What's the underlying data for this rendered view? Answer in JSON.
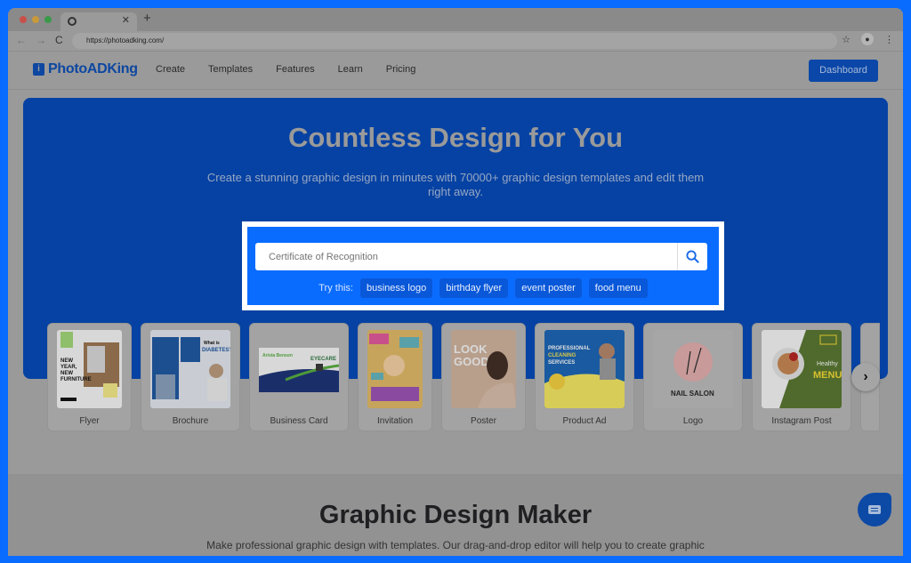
{
  "browser": {
    "tab_title": "",
    "url": "https://photoadking.com/",
    "traffic_lights": [
      "#c9504a",
      "#c99a3a",
      "#3a9a4a"
    ]
  },
  "header": {
    "logo_text": "PhotoADKing",
    "logo_mark": "i",
    "nav": [
      "Create",
      "Templates",
      "Features",
      "Learn",
      "Pricing"
    ],
    "dashboard_label": "Dashboard"
  },
  "hero": {
    "title": "Countless Design for You",
    "subtitle": "Create a stunning graphic design in minutes with 70000+ graphic design templates and edit them right away.",
    "search": {
      "placeholder": "Certificate of Recognition",
      "value": ""
    },
    "try_label": "Try this:",
    "suggestions": [
      "business logo",
      "birthday flyer",
      "event poster",
      "food menu"
    ]
  },
  "categories": [
    {
      "label": "Flyer",
      "thumb_text": "NEW YEAR, NEW FURNITURE"
    },
    {
      "label": "Brochure",
      "thumb_text": "What is DIABETES?"
    },
    {
      "label": "Business Card",
      "thumb_text": "EYECARE"
    },
    {
      "label": "Invitation",
      "thumb_text": ""
    },
    {
      "label": "Poster",
      "thumb_text": "LOOK GOOD"
    },
    {
      "label": "Product Ad",
      "thumb_text": "PROFESSIONAL CLEANING SERVICES"
    },
    {
      "label": "Logo",
      "thumb_text": "NAIL SALON"
    },
    {
      "label": "Instagram Post",
      "thumb_text": "Healthy MENU"
    }
  ],
  "section2": {
    "title": "Graphic Design Maker",
    "subtitle": "Make professional graphic design with templates. Our drag-and-drop editor will help you to create graphic"
  }
}
